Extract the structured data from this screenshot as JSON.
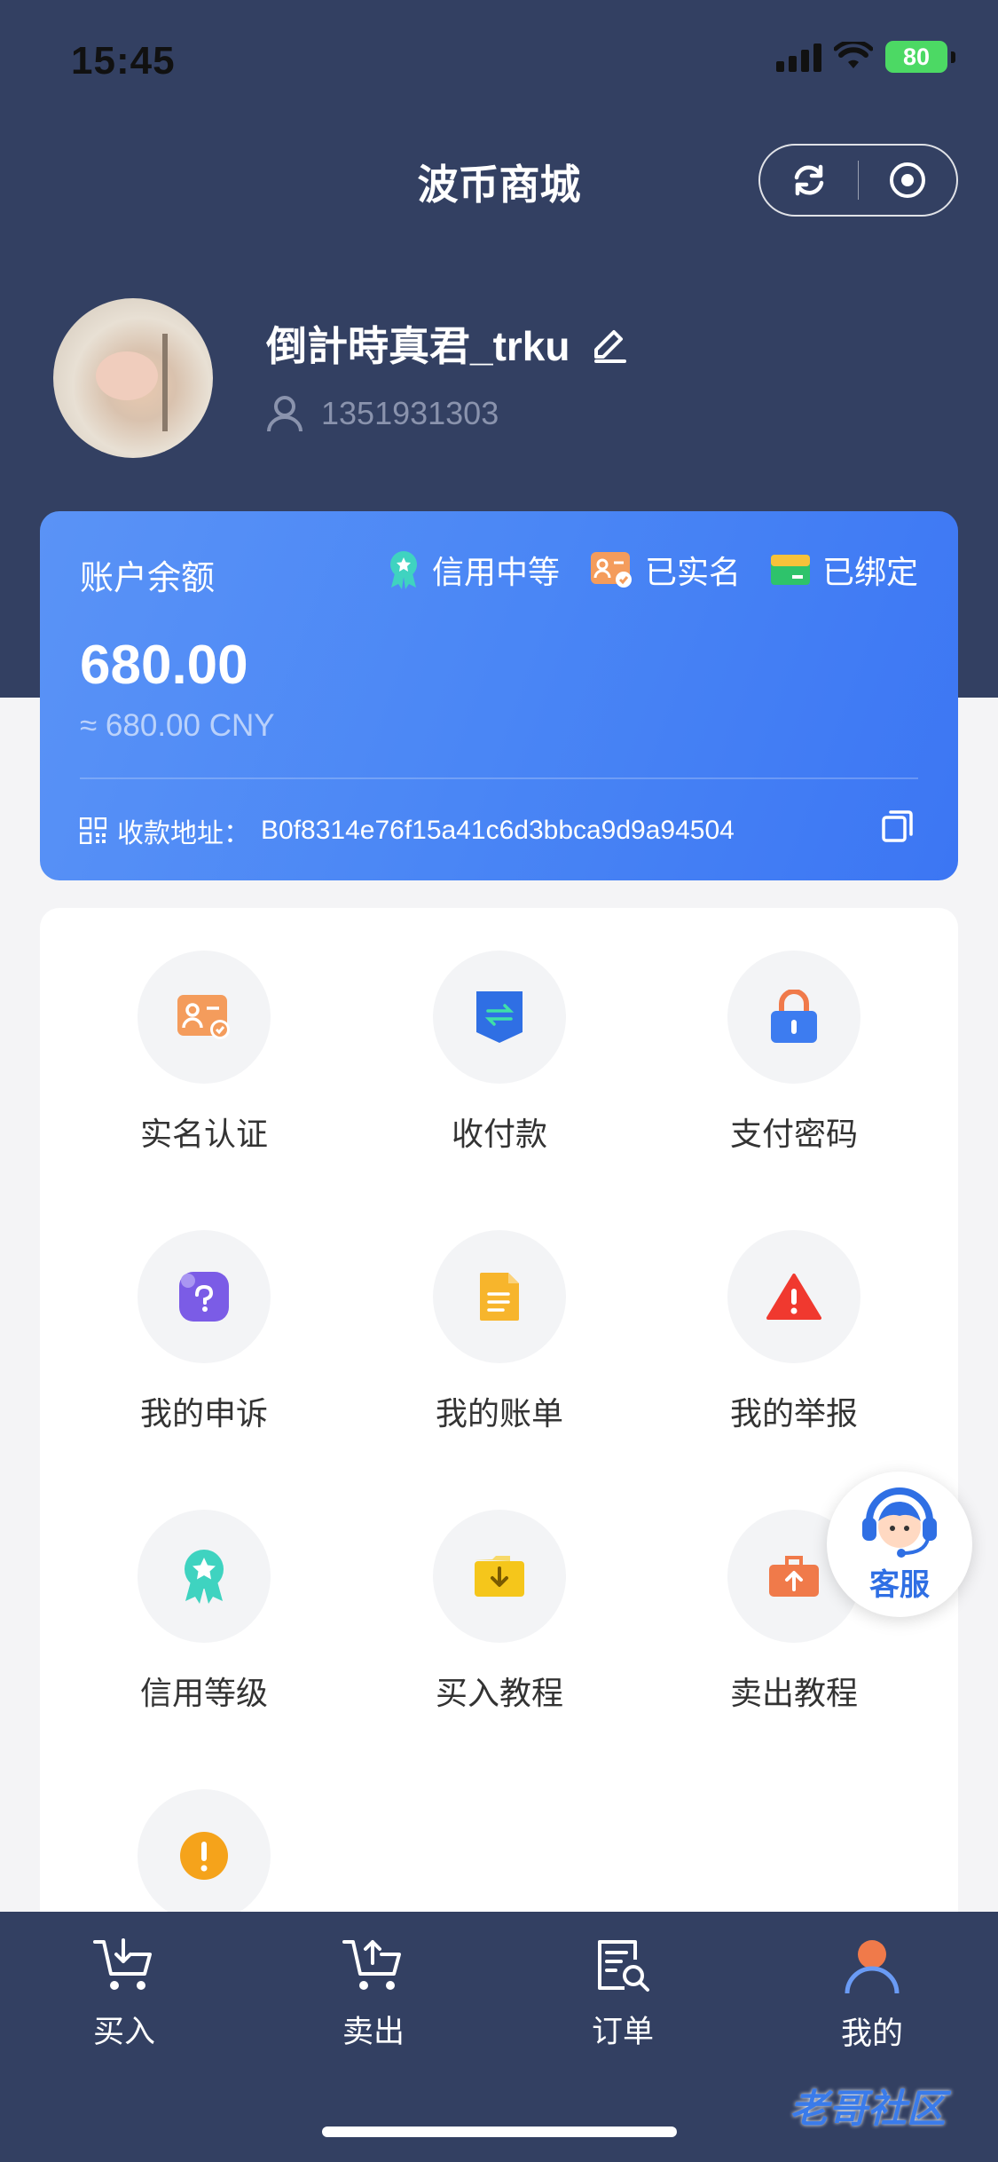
{
  "status_bar": {
    "time": "15:45",
    "battery": "80"
  },
  "nav": {
    "title": "波币商城"
  },
  "profile": {
    "username": "倒計時真君_trku",
    "phone": "1351931303"
  },
  "balance_card": {
    "title": "账户余额",
    "badges": [
      "信用中等",
      "已实名",
      "已绑定"
    ],
    "amount": "680.00",
    "amount_cny": "≈ 680.00 CNY",
    "address_label": "收款地址：",
    "address": "B0f8314e76f15a41c6d3bbca9d9a94504"
  },
  "menu": {
    "items": [
      {
        "label": "实名认证",
        "icon": "id-card-icon",
        "color": "#f49c5c"
      },
      {
        "label": "收付款",
        "icon": "transfer-icon",
        "color": "#2f6fe4"
      },
      {
        "label": "支付密码",
        "icon": "lock-icon",
        "color": "#3d7cf0"
      },
      {
        "label": "我的申诉",
        "icon": "question-icon",
        "color": "#7b5ce6"
      },
      {
        "label": "我的账单",
        "icon": "bill-icon",
        "color": "#f7b52c"
      },
      {
        "label": "我的举报",
        "icon": "warning-icon",
        "color": "#f0392f"
      },
      {
        "label": "信用等级",
        "icon": "medal-icon",
        "color": "#3fd3c0"
      },
      {
        "label": "买入教程",
        "icon": "buy-tutorial-icon",
        "color": "#f5c61b"
      },
      {
        "label": "卖出教程",
        "icon": "sell-tutorial-icon",
        "color": "#f07a4a"
      },
      {
        "label": "",
        "icon": "exclamation-icon",
        "color": "#f5a31b"
      }
    ]
  },
  "service": {
    "label": "客服"
  },
  "tabbar": {
    "tabs": [
      {
        "label": "买入",
        "icon": "cart-buy-icon"
      },
      {
        "label": "卖出",
        "icon": "cart-sell-icon"
      },
      {
        "label": "订单",
        "icon": "order-icon"
      },
      {
        "label": "我的",
        "icon": "user-icon"
      }
    ]
  },
  "watermark": "老哥社区",
  "colors": {
    "header": "#334062",
    "card_start": "#5a93f6",
    "card_end": "#3c76f3"
  }
}
